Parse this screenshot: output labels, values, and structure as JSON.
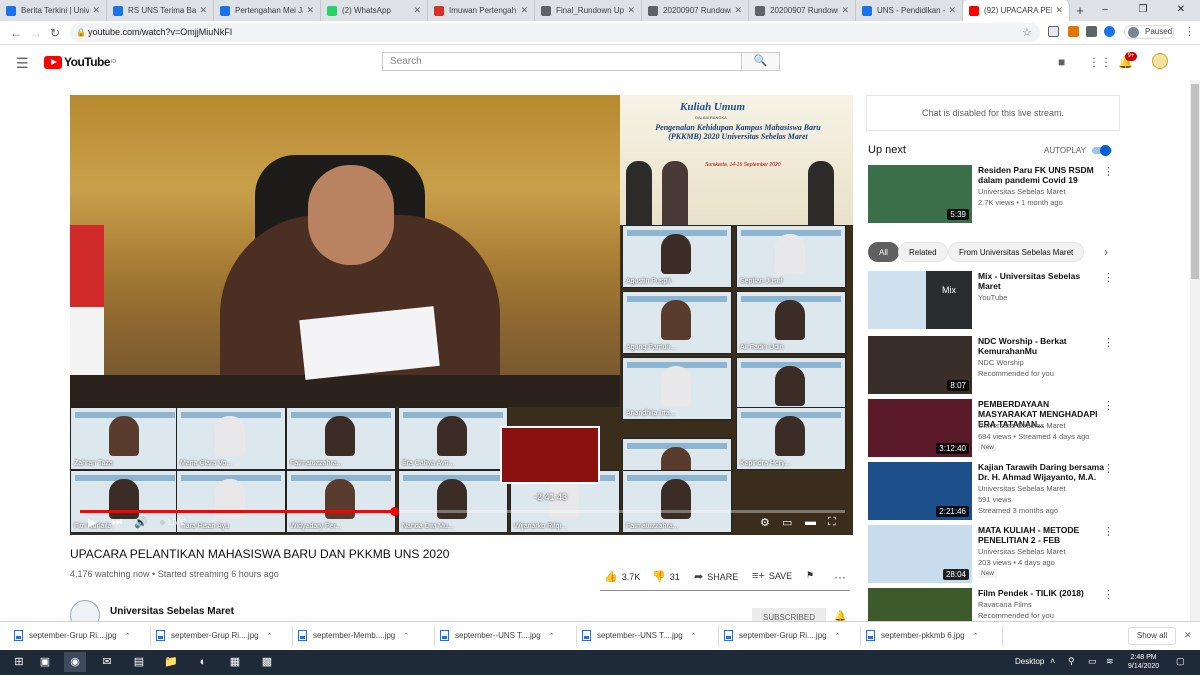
{
  "browser": {
    "tabs": [
      {
        "title": "Berita Terkini | Univ",
        "color": "#1a73e8"
      },
      {
        "title": "RS UNS Terima Ban",
        "color": "#1a73e8"
      },
      {
        "title": "Pertengahan Mei Ja",
        "color": "#1a73e8"
      },
      {
        "title": "(2) WhatsApp",
        "color": "#25d366"
      },
      {
        "title": "Imuwan Pertengah",
        "color": "#d93025"
      },
      {
        "title": "Final_Rundown Upa",
        "color": "#5f6368"
      },
      {
        "title": "20200907 Rundown",
        "color": "#5f6368"
      },
      {
        "title": "20200907 Rundown",
        "color": "#5f6368"
      },
      {
        "title": "UNS - Pendidikan -",
        "color": "#1a73e8"
      },
      {
        "title": "(92) UPACARA PELA",
        "color": "#ff0000"
      }
    ],
    "new_tab": "+",
    "window_controls": [
      "–",
      "❐",
      "✕"
    ],
    "url": "youtube.com/watch?v=OmjjMiuNkFI",
    "profile_status": "Paused"
  },
  "youtube": {
    "logo_text": "YouTube",
    "logo_sup": "ID",
    "search_placeholder": "Search",
    "notification_count": "9+"
  },
  "video": {
    "banner_line1": "Kuliah Umum",
    "banner_line2": "DALAM RANGKA",
    "banner_line3": "Pengenalan Kehidupan Kampus Mahasiswa Baru (PKKMB) 2020 Universitas Sebelas Maret",
    "banner_line4": "Surakarta, 14-16 September 2020",
    "participants": [
      "Agustin Puspit",
      "Septian Jusuf",
      "Agung Pamun...",
      "Ali Fadin Udin",
      "Anandhita Irta...",
      "annisa indah",
      "Zahran Taza",
      "Maria Clara Vo...",
      "Fatmatuzzahra...",
      "Era Cahya Avri...",
      "ADITYA ZAKKY ...",
      "Kapindra Hery...",
      "Fitri Nurlaila",
      "Tiara Hisan Ayu",
      "Widyadary Per...",
      "Nanda Dwi Mu...",
      "Wijanarko Rifqi...",
      "Fatmatuzzahra..."
    ],
    "hover_time": "-2:41:43",
    "live_label": "LIVE",
    "progress": 0.41
  },
  "info": {
    "title": "UPACARA PELANTIKAN MAHASISWA BARU DAN PKKMB UNS 2020",
    "meta": "4,176 watching now • Started streaming 6 hours ago",
    "likes": "3.7K",
    "dislikes": "31",
    "share": "SHARE",
    "save": "SAVE",
    "channel": "Universitas Sebelas Maret",
    "subscribed": "SUBSCRIBED"
  },
  "sidebar": {
    "chat_disabled": "Chat is disabled for this live stream.",
    "up_next": "Up next",
    "autoplay": "AUTOPLAY",
    "chips": [
      "All",
      "Related",
      "From Universitas Sebelas Maret"
    ],
    "recs": [
      {
        "title": "Residen Paru FK UNS RSDM dalam pandemi Covid 19",
        "channel": "Universitas Sebelas Maret",
        "views": "2.7K views • 1 month ago",
        "duration": "5:39",
        "color": "#3b6f4a"
      },
      {
        "title": "Mix - Universitas Sebelas Maret",
        "channel": "YouTube",
        "views": "",
        "duration": "",
        "mix": "Mix",
        "color": "#cfe0ee"
      },
      {
        "title": "NDC Worship - Berkat KemurahanMu",
        "channel": "NDC Worship",
        "views": "Recommended for you",
        "duration": "8:07",
        "color": "#3a2e2a"
      },
      {
        "title": "PEMBERDAYAAN MASYARAKAT MENGHADAPI ERA TATANAN...",
        "channel": "Universitas Sebelas Maret",
        "views": "684 views • Streamed 4 days ago",
        "duration": "3:12:40",
        "new": "New",
        "color": "#5a1a2a"
      },
      {
        "title": "Kajian Tarawih Daring bersama Dr. H. Ahmad Wijayanto, M.A.",
        "channel": "Universitas Sebelas Maret",
        "views": "591 views",
        "views2": "Streamed 3 months ago",
        "duration": "2:21:46",
        "color": "#1d4f8a"
      },
      {
        "title": "MATA KULIAH - METODE PENELITIAN 2 - FEB",
        "channel": "Universitas Sebelas Maret",
        "views": "203 views • 4 days ago",
        "duration": "28:04",
        "new": "New",
        "color": "#c8dced"
      },
      {
        "title": "Film Pendek - TILIK (2018)",
        "channel": "Ravacana Films",
        "views": "Recommended for you",
        "duration": "",
        "color": "#3d5a2a"
      }
    ]
  },
  "downloads": {
    "items": [
      "september-Grup Ri....jpg",
      "september-Grup Ri....jpg",
      "september-Memb....jpg",
      "september--UNS T....jpg",
      "september--UNS T....jpg",
      "september-Grup Ri....jpg",
      "september-pkkmb 6.jpg"
    ],
    "show_all": "Show all"
  },
  "taskbar": {
    "desktop": "Desktop",
    "time": "2:48 PM",
    "date": "9/14/2020"
  }
}
